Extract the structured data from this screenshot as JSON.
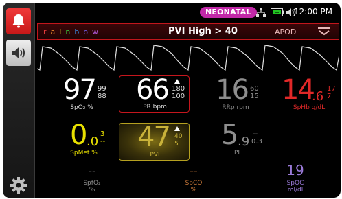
{
  "status": {
    "mode_badge": "NEONATAL",
    "time": "12:00 PM"
  },
  "banner": {
    "brand": "rainbow",
    "alarm_message": "PVI High > 40",
    "apod": "APOD"
  },
  "colors": {
    "alarm_red": "#c5161d",
    "spmet_yellow": "#e8e000",
    "spco_orange": "#cc7a3a",
    "spoc_purple": "#9a7ad8",
    "pvi_gold": "#c9b23a",
    "gray_value": "#8e8e8e"
  },
  "params": {
    "spo2": {
      "value": "97",
      "upper": "99",
      "lower": "88",
      "label": "SpO₂ %"
    },
    "pr": {
      "value": "66",
      "upper": "180",
      "lower": "100",
      "label": "PR bpm"
    },
    "rrp": {
      "value": "16",
      "upper": "60",
      "lower": "15",
      "label": "RRp rpm"
    },
    "sphb": {
      "value_int": "14",
      "value_dec": ".6",
      "upper": "17",
      "lower": "7",
      "label": "SpHb g/dL"
    },
    "spmet": {
      "value_int": "0",
      "value_dec": ".0",
      "upper": "3",
      "lower": "--",
      "label": "SpMet %"
    },
    "pvi": {
      "value": "47",
      "upper": "40",
      "lower": "5",
      "label": "PVI"
    },
    "pi": {
      "value_int": "5",
      "value_dec": ".9",
      "upper": "--",
      "lower": "0.3",
      "label": "PI"
    },
    "spfo2": {
      "value": "--",
      "label_1": "SpfO₂",
      "label_2": "%"
    },
    "spco": {
      "value": "--",
      "label_1": "SpCO",
      "label_2": "%"
    },
    "spoc": {
      "value": "19",
      "label_1": "SpOC",
      "label_2": "ml/dl"
    }
  },
  "icons": {
    "alarm": "bell-icon",
    "audio": "speaker-icon",
    "settings": "gear-icon",
    "network": "network-icon",
    "battery": "battery-icon",
    "volume": "volume-icon",
    "collapse": "chevron-down-icon",
    "arrow": "up-arrow-icon"
  }
}
